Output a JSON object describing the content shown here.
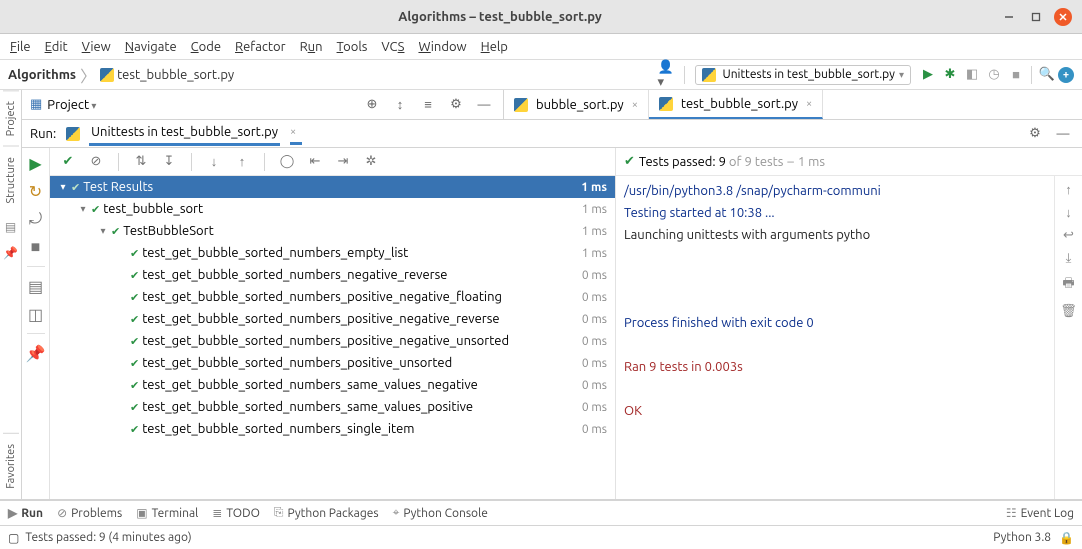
{
  "window": {
    "title": "Algorithms – test_bubble_sort.py"
  },
  "menu": [
    "File",
    "Edit",
    "View",
    "Navigate",
    "Code",
    "Refactor",
    "Run",
    "Tools",
    "VCS",
    "Window",
    "Help"
  ],
  "breadcrumb": {
    "project": "Algorithms",
    "file": "test_bubble_sort.py"
  },
  "run_config": "Unittests in test_bubble_sort.py",
  "project_panel": {
    "label": "Project"
  },
  "editor_tabs": [
    {
      "name": "bubble_sort.py",
      "active": false
    },
    {
      "name": "test_bubble_sort.py",
      "active": true
    }
  ],
  "run_panel": {
    "label": "Run:",
    "tab": "Unittests in test_bubble_sort.py",
    "status": {
      "prefix": "Tests passed:",
      "passed": "9",
      "of": "of 9 tests",
      "time": "1 ms"
    }
  },
  "tree": {
    "header": {
      "name": "Test Results",
      "time": "1 ms"
    },
    "module": {
      "name": "test_bubble_sort",
      "time": "1 ms"
    },
    "class": {
      "name": "TestBubbleSort",
      "time": "1 ms"
    },
    "tests": [
      {
        "name": "test_get_bubble_sorted_numbers_empty_list",
        "time": "1 ms"
      },
      {
        "name": "test_get_bubble_sorted_numbers_negative_reverse",
        "time": "0 ms"
      },
      {
        "name": "test_get_bubble_sorted_numbers_positive_negative_floating",
        "time": "0 ms"
      },
      {
        "name": "test_get_bubble_sorted_numbers_positive_negative_reverse",
        "time": "0 ms"
      },
      {
        "name": "test_get_bubble_sorted_numbers_positive_negative_unsorted",
        "time": "0 ms"
      },
      {
        "name": "test_get_bubble_sorted_numbers_positive_unsorted",
        "time": "0 ms"
      },
      {
        "name": "test_get_bubble_sorted_numbers_same_values_negative",
        "time": "0 ms"
      },
      {
        "name": "test_get_bubble_sorted_numbers_same_values_positive",
        "time": "0 ms"
      },
      {
        "name": "test_get_bubble_sorted_numbers_single_item",
        "time": "0 ms"
      }
    ]
  },
  "console": {
    "lines": [
      {
        "cls": "blue",
        "text": "/usr/bin/python3.8 /snap/pycharm-communi"
      },
      {
        "cls": "blue",
        "text": "Testing started at 10:38 ..."
      },
      {
        "cls": "black",
        "text": "Launching unittests with arguments pytho"
      },
      {
        "cls": "black",
        "text": ""
      },
      {
        "cls": "black",
        "text": ""
      },
      {
        "cls": "black",
        "text": ""
      },
      {
        "cls": "blue",
        "text": "Process finished with exit code 0"
      },
      {
        "cls": "black",
        "text": ""
      },
      {
        "cls": "red",
        "text": "Ran 9 tests in 0.003s"
      },
      {
        "cls": "black",
        "text": ""
      },
      {
        "cls": "red",
        "text": "OK"
      }
    ]
  },
  "left_rail": [
    "Project",
    "Structure",
    "Favorites"
  ],
  "bottom_tools": [
    "Run",
    "Problems",
    "Terminal",
    "TODO",
    "Python Packages",
    "Python Console"
  ],
  "event_log": "Event Log",
  "status": {
    "msg": "Tests passed: 9 (4 minutes ago)",
    "interpreter": "Python 3.8"
  }
}
